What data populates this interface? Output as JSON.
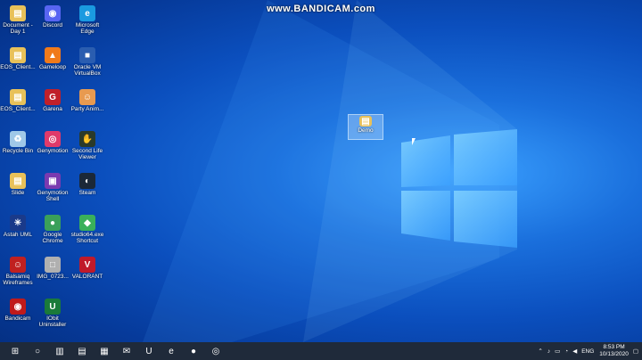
{
  "watermark": "www.BANDICAM.com",
  "desktop": {
    "icons": [
      {
        "label": "Document - Day 1",
        "color": "#e8c15a",
        "glyph": "▤",
        "icon": "folder-icon"
      },
      {
        "label": "Discord",
        "color": "#5865f2",
        "glyph": "◉",
        "icon": "discord-icon"
      },
      {
        "label": "Microsoft Edge",
        "color": "#1a9ae0",
        "glyph": "e",
        "icon": "edge-icon"
      },
      {
        "label": "EOS_Client...",
        "color": "#e8c15a",
        "glyph": "▤",
        "icon": "folder-icon"
      },
      {
        "label": "Gameloop",
        "color": "#f07a1a",
        "glyph": "▲",
        "icon": "gameloop-icon"
      },
      {
        "label": "Oracle VM VirtualBox",
        "color": "#2a5db0",
        "glyph": "■",
        "icon": "virtualbox-icon"
      },
      {
        "label": "EOS_Client...",
        "color": "#e8c15a",
        "glyph": "▤",
        "icon": "folder-icon"
      },
      {
        "label": "Garena",
        "color": "#c0202a",
        "glyph": "G",
        "icon": "garena-icon"
      },
      {
        "label": "Party Anim...",
        "color": "#e89a50",
        "glyph": "☺",
        "icon": "party-animals-icon"
      },
      {
        "label": "Recycle Bin",
        "color": "#9fc8e8",
        "glyph": "♻",
        "icon": "recycle-bin-icon"
      },
      {
        "label": "Genymotion",
        "color": "#e03a6a",
        "glyph": "◎",
        "icon": "genymotion-icon"
      },
      {
        "label": "Second Life Viewer",
        "color": "#2a3a2a",
        "glyph": "✋",
        "icon": "second-life-icon"
      },
      {
        "label": "Slide",
        "color": "#e8c15a",
        "glyph": "▤",
        "icon": "folder-icon"
      },
      {
        "label": "Genymotion Shell",
        "color": "#7a3ab0",
        "glyph": "▣",
        "icon": "genymotion-shell-icon"
      },
      {
        "label": "Steam",
        "color": "#1b2838",
        "glyph": "◐",
        "icon": "steam-icon"
      },
      {
        "label": "Astah UML",
        "color": "#1a3a8a",
        "glyph": "✳",
        "icon": "astah-icon"
      },
      {
        "label": "Google Chrome",
        "color": "#3aa05a",
        "glyph": "●",
        "icon": "chrome-icon"
      },
      {
        "label": "studio64.exe Shortcut",
        "color": "#3ab05a",
        "glyph": "◆",
        "icon": "android-studio-icon"
      },
      {
        "label": "Balsamiq Wireframes",
        "color": "#c02020",
        "glyph": "☺",
        "icon": "balsamiq-icon"
      },
      {
        "label": "IMG_0723...",
        "color": "#b0b0b0",
        "glyph": "□",
        "icon": "image-file-icon"
      },
      {
        "label": "VALORANT",
        "color": "#c01a2a",
        "glyph": "V",
        "icon": "valorant-icon"
      },
      {
        "label": "Bandicam",
        "color": "#c01a1a",
        "glyph": "◉",
        "icon": "bandicam-icon"
      },
      {
        "label": "IObit Uninstaller",
        "color": "#1a7a3a",
        "glyph": "U",
        "icon": "iobit-icon"
      }
    ],
    "demo_folder": {
      "label": "Demo",
      "icon": "folder-icon"
    }
  },
  "taskbar": {
    "apps": [
      {
        "icon": "windows-start-icon",
        "glyph": "⊞"
      },
      {
        "icon": "search-icon",
        "glyph": "○"
      },
      {
        "icon": "task-view-icon",
        "glyph": "▥"
      },
      {
        "icon": "file-explorer-icon",
        "glyph": "▤"
      },
      {
        "icon": "store-icon",
        "glyph": "▦"
      },
      {
        "icon": "mail-icon",
        "glyph": "✉"
      },
      {
        "icon": "iobit-taskbar-icon",
        "glyph": "U"
      },
      {
        "icon": "edge-taskbar-icon",
        "glyph": "e"
      },
      {
        "icon": "bandicam-taskbar-icon",
        "glyph": "●"
      },
      {
        "icon": "chrome-taskbar-icon",
        "glyph": "◎"
      }
    ],
    "language": "ENG",
    "time": "8:53 PM",
    "date": "10/13/2020"
  }
}
